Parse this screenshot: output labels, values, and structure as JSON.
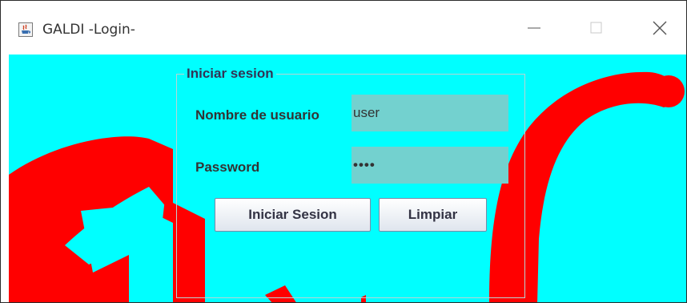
{
  "window": {
    "title": "GALDI -Login-",
    "background_color": "#00ffff",
    "logo_color": "#ff0000"
  },
  "titlebar_buttons": {
    "minimize_icon": "minimize-icon",
    "maximize_icon": "maximize-icon",
    "close_icon": "close-icon"
  },
  "login_panel": {
    "legend": "Iniciar sesion",
    "username_label": "Nombre de usuario",
    "username_value": "user",
    "password_label": "Password",
    "password_masked": "••••",
    "login_button": "Iniciar Sesion",
    "clear_button": "Limpiar"
  }
}
